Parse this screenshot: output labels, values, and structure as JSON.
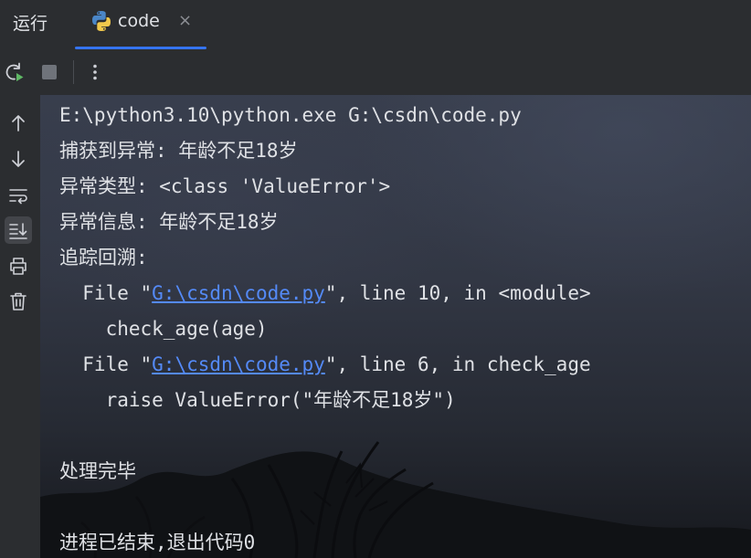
{
  "panel": {
    "title": "运行"
  },
  "tab": {
    "label": "code",
    "close_glyph": "×",
    "icon": "python-icon"
  },
  "toolbar": {
    "rerun": "rerun-icon",
    "stop": "stop-icon",
    "more": "more-vertical-icon"
  },
  "sidebar": {
    "items": [
      {
        "icon": "arrow-up-icon"
      },
      {
        "icon": "arrow-down-icon"
      },
      {
        "icon": "soft-wrap-icon"
      },
      {
        "icon": "scroll-to-end-icon",
        "active": true
      },
      {
        "icon": "print-icon"
      },
      {
        "icon": "trash-icon"
      }
    ]
  },
  "console": {
    "cmd": "E:\\python3.10\\python.exe G:\\csdn\\code.py",
    "line2": "捕获到异常: 年龄不足18岁",
    "line3": "异常类型: <class 'ValueError'>",
    "line4": "异常信息: 年龄不足18岁",
    "line5": "追踪回溯:",
    "tb1_prefix": "  File \"",
    "tb1_link": "G:\\csdn\\code.py",
    "tb1_suffix": "\", line 10, in <module>",
    "tb1_code": "    check_age(age)",
    "tb2_prefix": "  File \"",
    "tb2_link": "G:\\csdn\\code.py",
    "tb2_suffix": "\", line 6, in check_age",
    "tb2_code": "    raise ValueError(\"年龄不足18岁\")",
    "done": "处理完毕",
    "exit": "进程已结束,退出代码0"
  },
  "colors": {
    "accent": "#3574f0",
    "link": "#548af7",
    "text": "#dfe1e5",
    "run_green": "#5fb865"
  }
}
